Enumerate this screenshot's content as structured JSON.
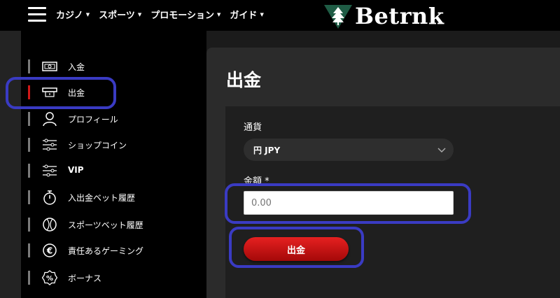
{
  "header": {
    "nav": [
      {
        "label": "カジノ"
      },
      {
        "label": "スポーツ"
      },
      {
        "label": "プロモーション"
      },
      {
        "label": "ガイド"
      }
    ],
    "logo_text": "Betrnk"
  },
  "sidebar": {
    "items": [
      {
        "label": "入金",
        "icon": "cash-icon"
      },
      {
        "label": "出金",
        "icon": "atm-withdraw-icon",
        "active": true
      },
      {
        "label": "プロフィール",
        "icon": "user-icon"
      },
      {
        "label": "ショップコイン",
        "icon": "sliders-icon"
      },
      {
        "label": "VIP",
        "icon": "sliders-icon"
      },
      {
        "label": "入出金ベット履歴",
        "icon": "stopwatch-icon"
      },
      {
        "label": "スポーツベット履歴",
        "icon": "ball-icon"
      },
      {
        "label": "責任あるゲーミング",
        "icon": "euro-coin-icon"
      },
      {
        "label": "ボーナス",
        "icon": "percent-badge-icon"
      }
    ]
  },
  "main": {
    "title": "出金",
    "currency_label": "通貨",
    "currency_value": "円 JPY",
    "amount_label": "金額 *",
    "amount_placeholder": "0.00",
    "submit_label": "出金"
  },
  "colors": {
    "accent_red": "#d01818",
    "highlight_blue": "#3a3bc3",
    "logo_green": "#1f5c45"
  }
}
